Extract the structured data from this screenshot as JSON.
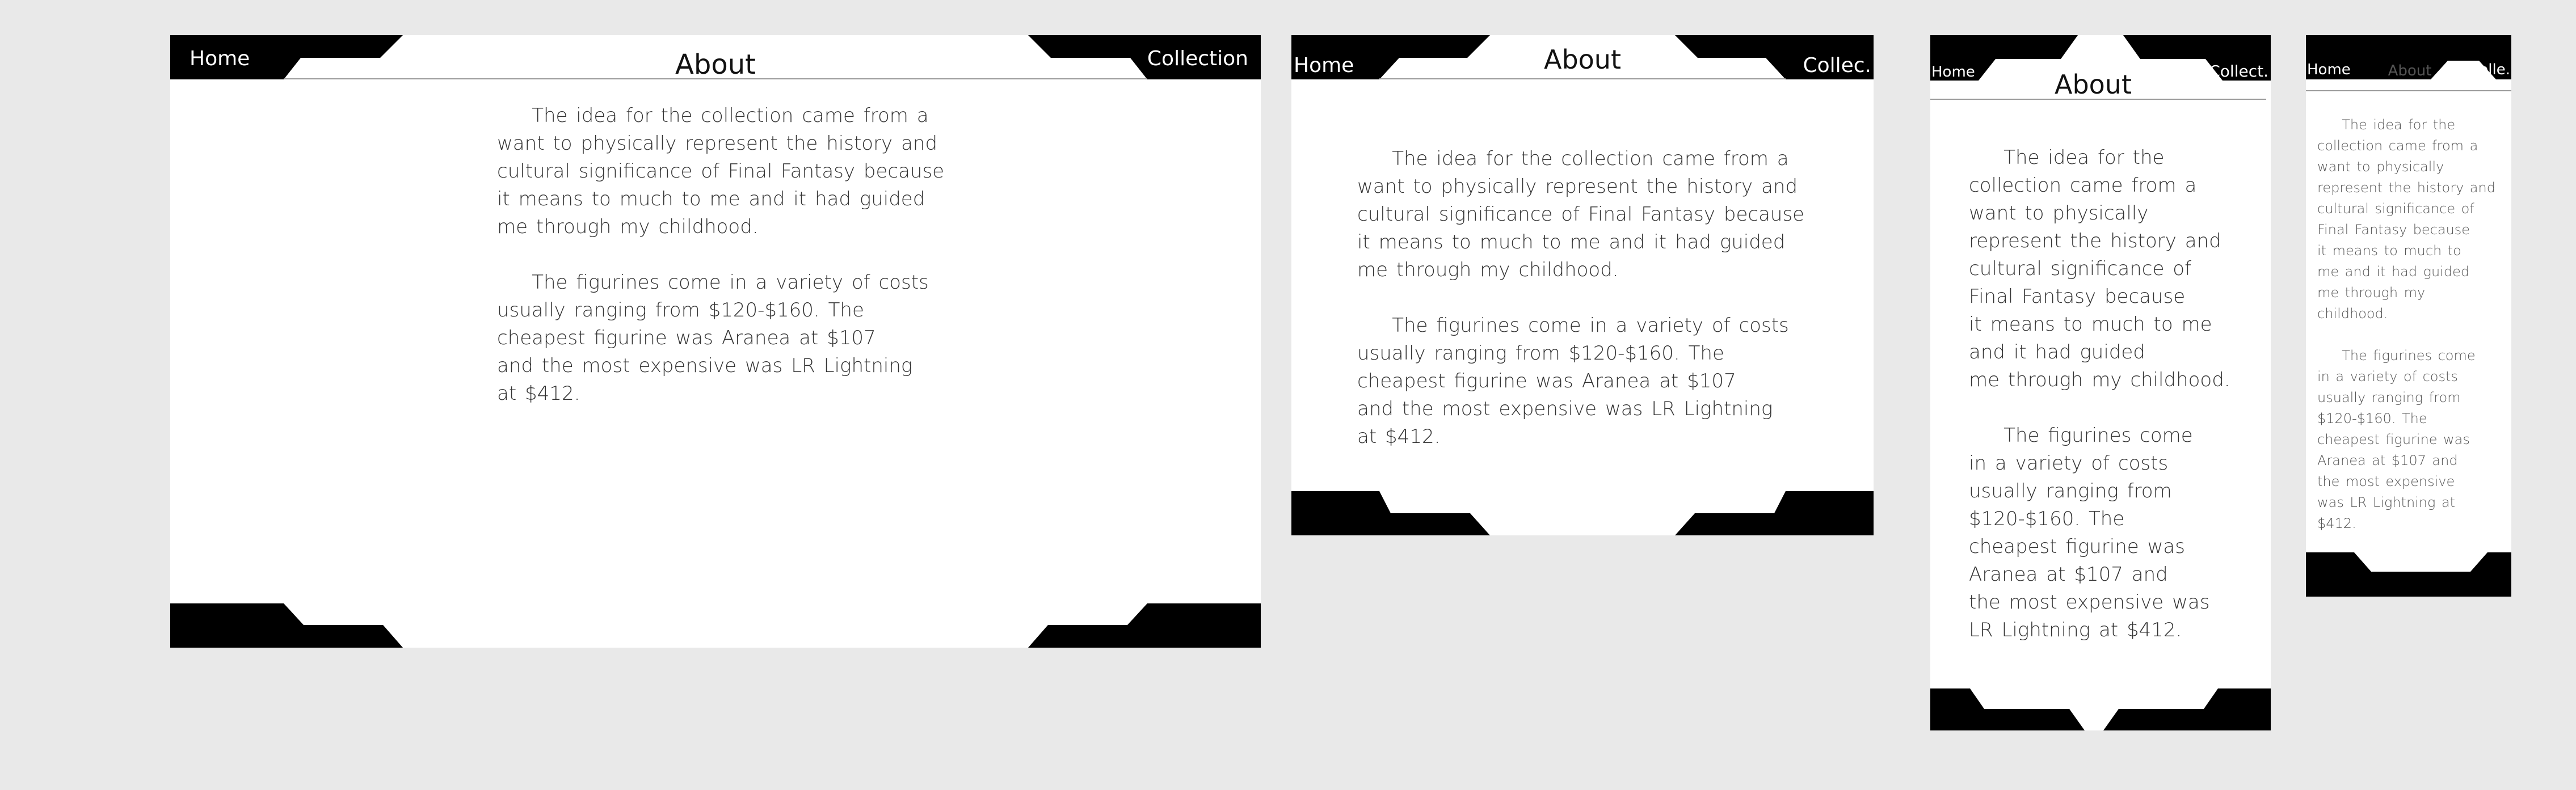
{
  "colors": {
    "page_background": "#e9e9e9",
    "frame": "#ffffff",
    "chrome": "#000000",
    "nav_text": "#ffffff",
    "body_text": "#333333"
  },
  "views": [
    {
      "nav": {
        "home": "Home",
        "collection": "Collection"
      },
      "title": "About",
      "paragraphs": [
        "The idea for the collection came from a\nwant to physically represent the history and\ncultural significance of Final Fantasy because\nit means to much to me and it had guided\nme through my childhood.",
        "The figurines come in a variety of costs\nusually ranging from $120-$160. The\ncheapest figurine was Aranea at $107\nand the most expensive was LR Lightning\nat $412."
      ]
    },
    {
      "nav": {
        "home": "Home",
        "collection": "Collec."
      },
      "title": "About",
      "paragraphs": [
        "The idea for the collection came from a\nwant to physically represent the history and\ncultural significance of Final Fantasy because\nit means to much to me and it had guided\nme through my childhood.",
        "The figurines come in a variety of costs\nusually ranging from $120-$160. The\ncheapest figurine was Aranea at $107\nand the most expensive was LR Lightning\nat $412."
      ]
    },
    {
      "nav": {
        "home": "Home",
        "collection": "Collect."
      },
      "title": "About",
      "paragraphs": [
        "The idea for the\ncollection came from a\nwant to physically\nrepresent the history and\ncultural significance of\nFinal Fantasy because\nit means to much to me\nand it had guided\nme through my childhood.",
        "The figurines come\nin a variety of costs\nusually ranging from\n$120-$160. The\ncheapest figurine was\nAranea at $107 and\nthe most expensive was\nLR Lightning at $412."
      ]
    },
    {
      "nav": {
        "home": "Home",
        "collection": "Colle."
      },
      "title": "About",
      "paragraphs": [
        "The idea for the\ncollection came from a\nwant to physically\nrepresent the history and\ncultural significance of\nFinal Fantasy because\nit means to much to\nme and it had guided\nme through my\nchildhood.",
        "The figurines come\nin a variety of costs\nusually ranging from\n$120-$160. The\ncheapest figurine was\nAranea at $107 and\nthe most expensive\nwas LR Lightning at\n$412."
      ]
    }
  ]
}
